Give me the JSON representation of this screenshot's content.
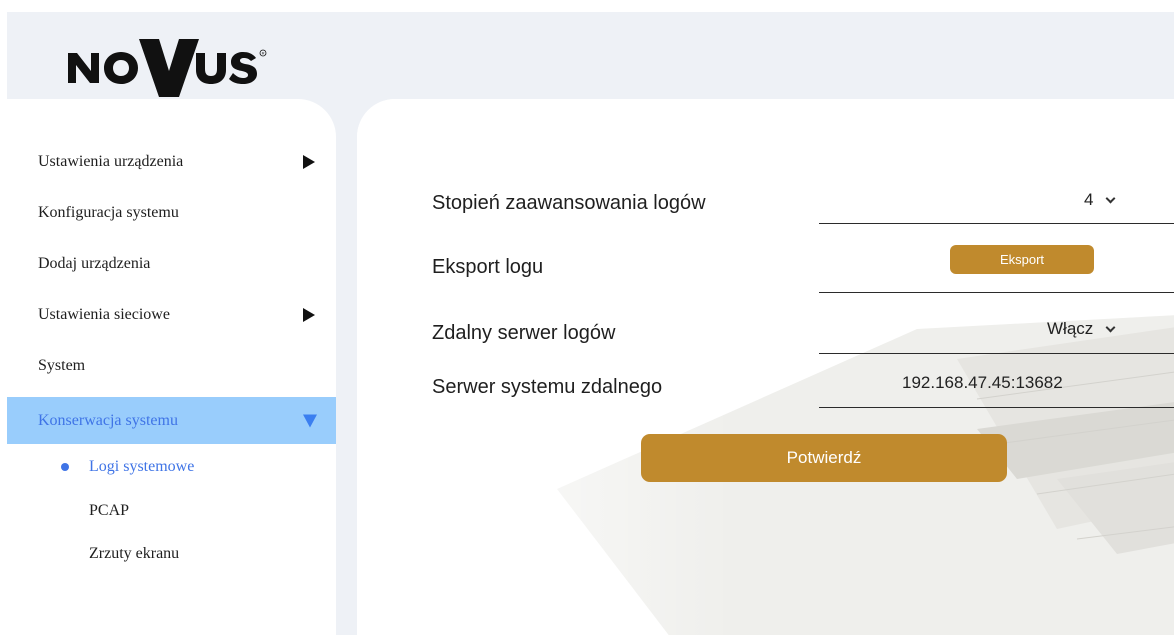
{
  "brand": {
    "logo_text": "NOVUS",
    "logo_icon": "novus-logo",
    "accent_color": "#c08a2d"
  },
  "sidebar": {
    "items": [
      {
        "label": "Ustawienia urządzenia",
        "icon": "arrow-right-icon"
      },
      {
        "label": "Konfiguracja systemu"
      },
      {
        "label": "Dodaj urządzenia"
      },
      {
        "label": "Ustawienia sieciowe",
        "icon": "arrow-right-icon"
      },
      {
        "label": "System"
      },
      {
        "label": "Konserwacja systemu",
        "icon": "arrow-down-icon",
        "active": true
      }
    ],
    "subitems": [
      {
        "label": "Logi systemowe",
        "active": true
      },
      {
        "label": "PCAP"
      },
      {
        "label": "Zrzuty ekranu"
      }
    ],
    "active_color": "#3f74e6",
    "active_bg": "#99cdfc"
  },
  "form": {
    "log_level": {
      "label": "Stopień zaawansowania logów",
      "value": "4"
    },
    "log_export": {
      "label": "Eksport logu",
      "button": "Eksport"
    },
    "remote_log_server": {
      "label": "Zdalny serwer logów",
      "value": "Włącz"
    },
    "remote_system_server": {
      "label": "Serwer systemu zdalnego",
      "value": "192.168.47.45:13682"
    },
    "confirm_button": "Potwierdź"
  }
}
